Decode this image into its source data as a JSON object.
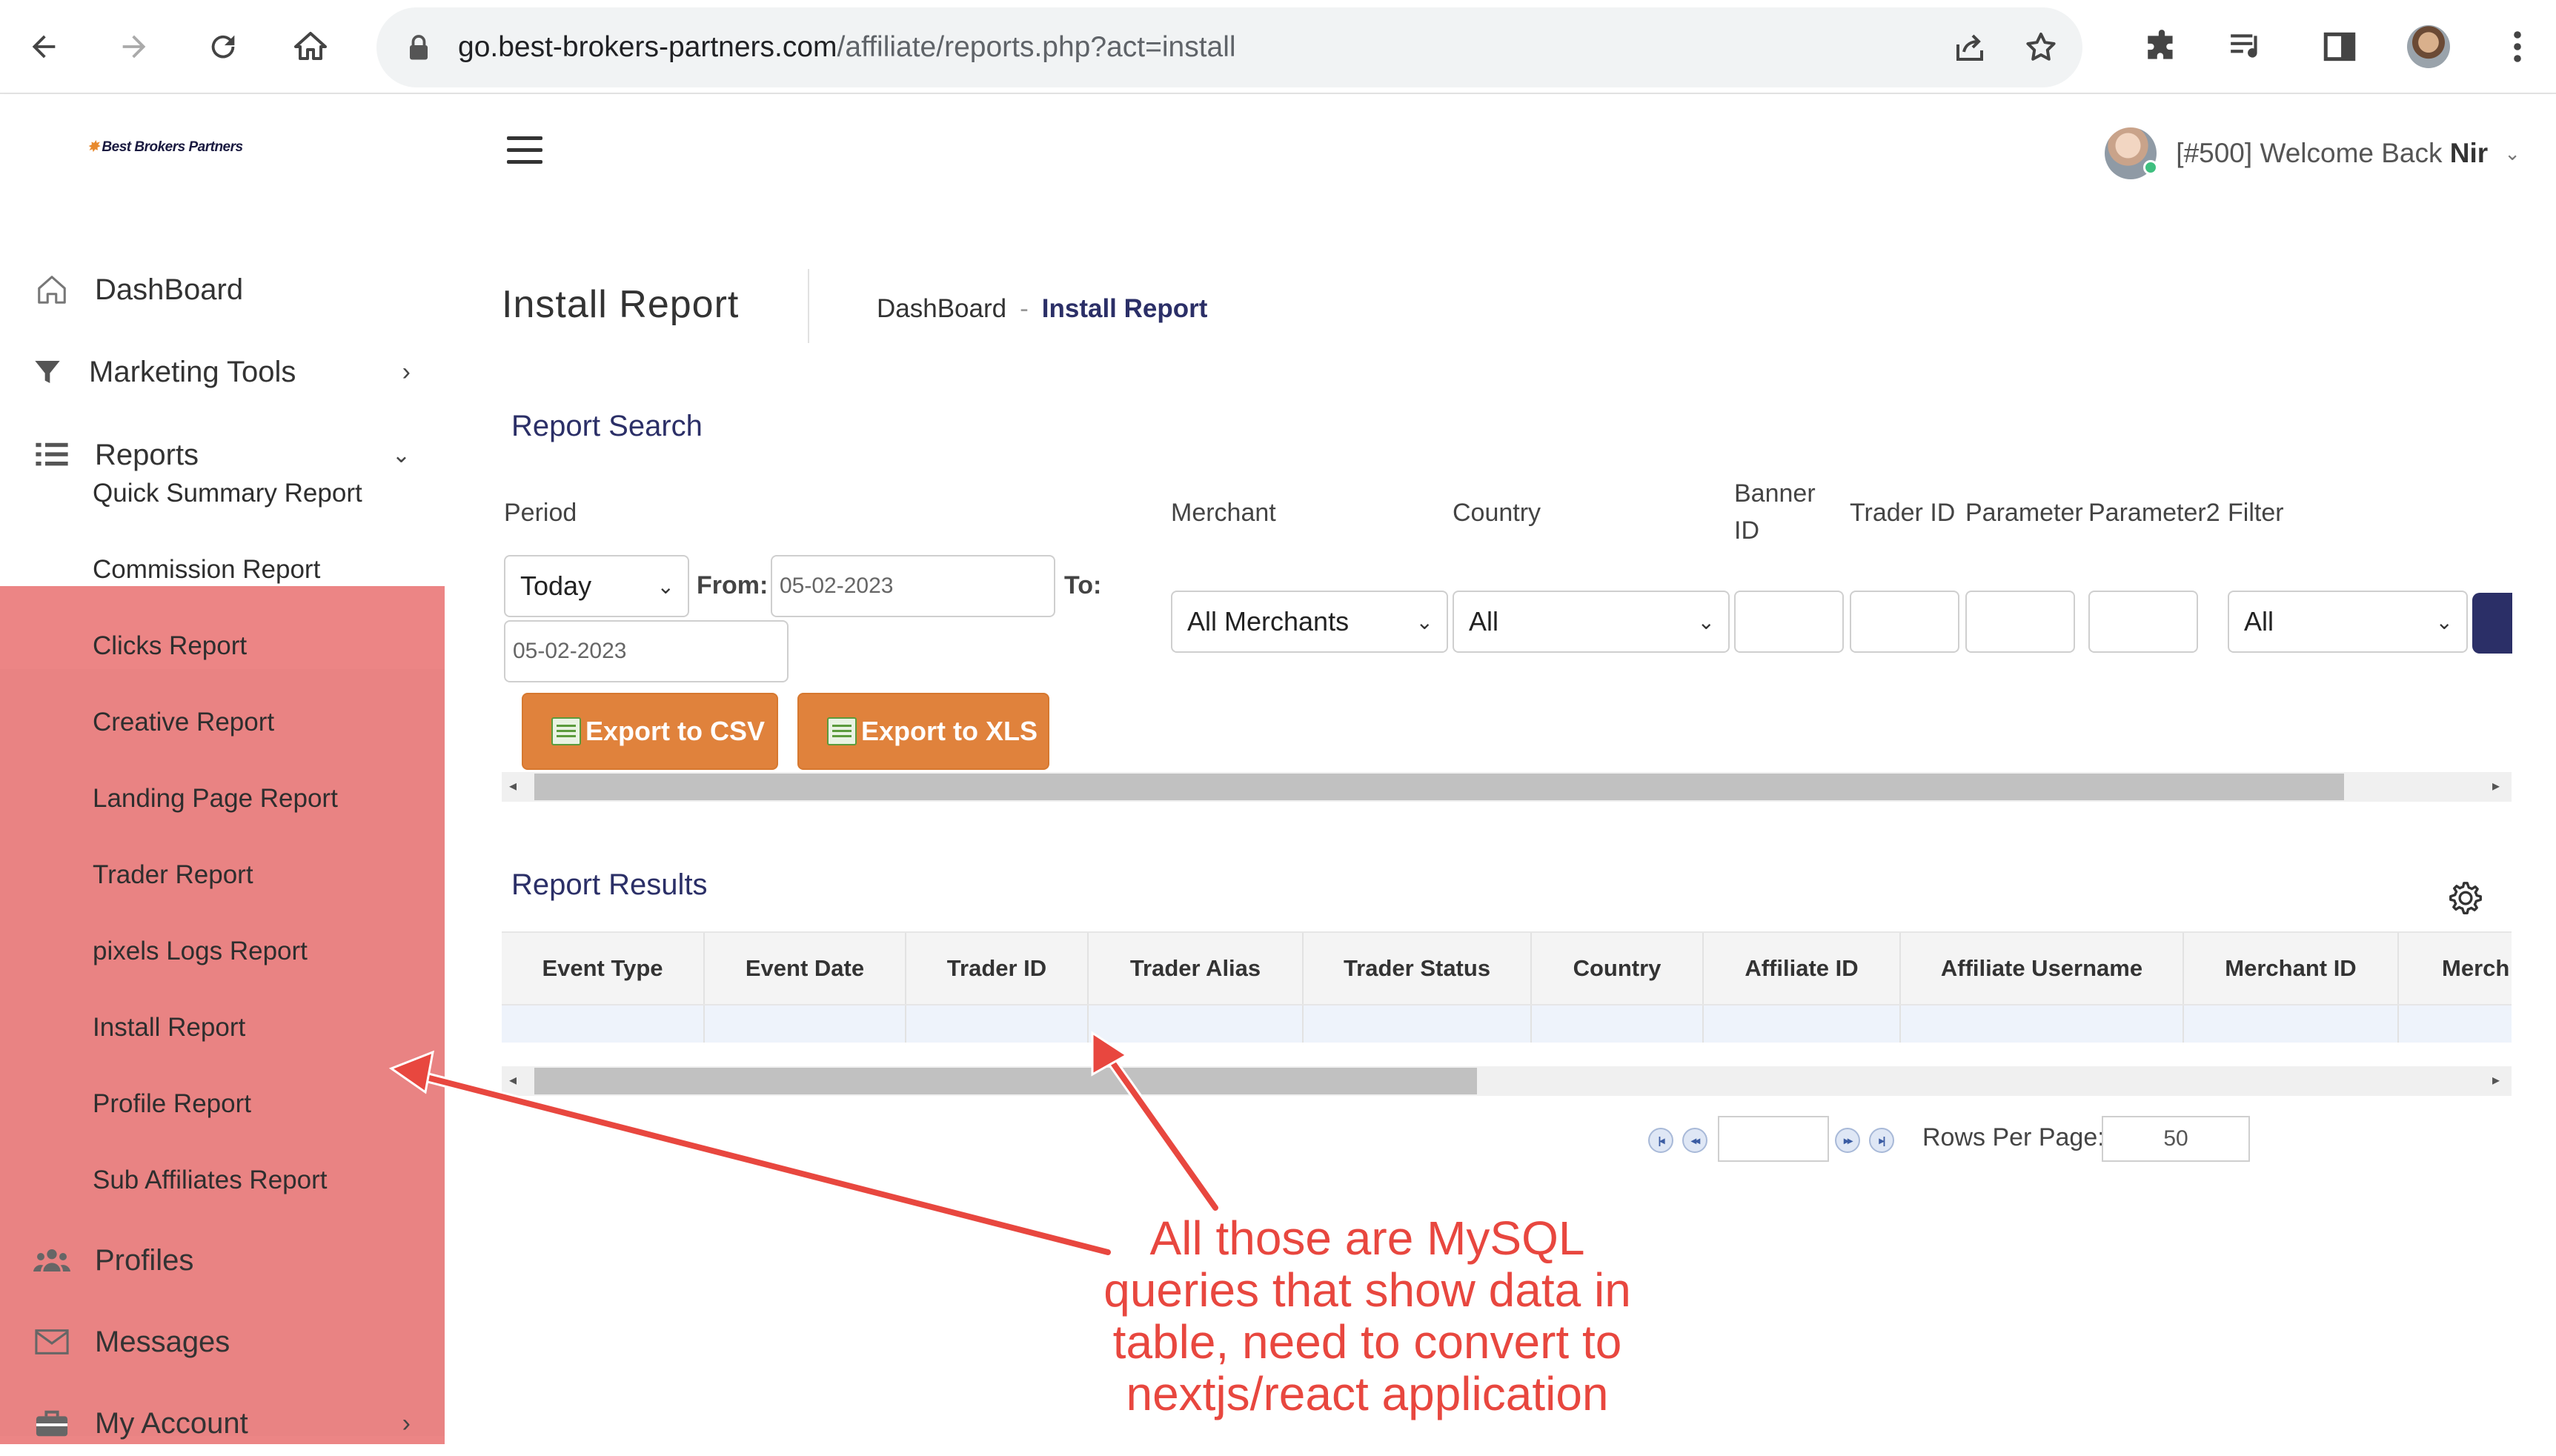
{
  "browser": {
    "url_domain": "go.best-brokers-partners.com",
    "url_path": "/affiliate/reports.php?act=install",
    "icons": [
      "back-icon",
      "forward-icon",
      "reload-icon",
      "home-icon",
      "lock-icon",
      "share-icon",
      "star-icon",
      "extensions-icon",
      "media-icon",
      "side-panel-icon",
      "profile-icon",
      "more-icon"
    ]
  },
  "header": {
    "logo_text": "Best Brokers Partners",
    "welcome_prefix": "[#500] Welcome Back ",
    "welcome_name": "Nir"
  },
  "sidebar": {
    "items": [
      {
        "label": "DashBoard",
        "icon": "home-icon"
      },
      {
        "label": "Marketing Tools",
        "icon": "filter-icon"
      },
      {
        "label": "Reports",
        "icon": "list-icon"
      },
      {
        "label": "Profiles",
        "icon": "users-icon"
      },
      {
        "label": "Messages",
        "icon": "envelope-icon"
      },
      {
        "label": "My Account",
        "icon": "briefcase-icon"
      }
    ],
    "report_links": [
      "Quick Summary Report",
      "Commission Report",
      "Clicks Report",
      "Creative Report",
      "Landing Page Report",
      "Trader Report",
      "pixels Logs Report",
      "Install Report",
      "Profile Report",
      "Sub Affiliates Report"
    ]
  },
  "page": {
    "title": "Install Report",
    "breadcrumb_home": "DashBoard",
    "breadcrumb_sep": "-",
    "breadcrumb_current": "Install Report"
  },
  "search": {
    "section_title": "Report Search",
    "period_label": "Period",
    "period_value": "Today",
    "from_label": "From:",
    "from_value": "05-02-2023",
    "to_label": "To:",
    "to_value": "05-02-2023",
    "merchant_label": "Merchant",
    "merchant_value": "All Merchants",
    "country_label": "Country",
    "country_value": "All",
    "banner_label_1": "Banner",
    "banner_label_2": "ID",
    "trader_label": "Trader ID",
    "parameter_label": "Parameter",
    "parameter2_label": "Parameter2",
    "filter_label": "Filter",
    "filter_value": "All",
    "export_csv": "Export to CSV",
    "export_xls": "Export to XLS"
  },
  "results": {
    "section_title": "Report Results",
    "columns": [
      "Event Type",
      "Event Date",
      "Trader ID",
      "Trader Alias",
      "Trader Status",
      "Country",
      "Affiliate ID",
      "Affiliate Username",
      "Merchant ID",
      "Merch"
    ],
    "rows_per_page_label": "Rows Per Page:",
    "rows_per_page_value": "50"
  },
  "annotation": {
    "lines": [
      "All those are MySQL",
      "queries that show data in",
      "table, need to convert to",
      "nextjs/react application"
    ],
    "color": "#e8473f"
  }
}
